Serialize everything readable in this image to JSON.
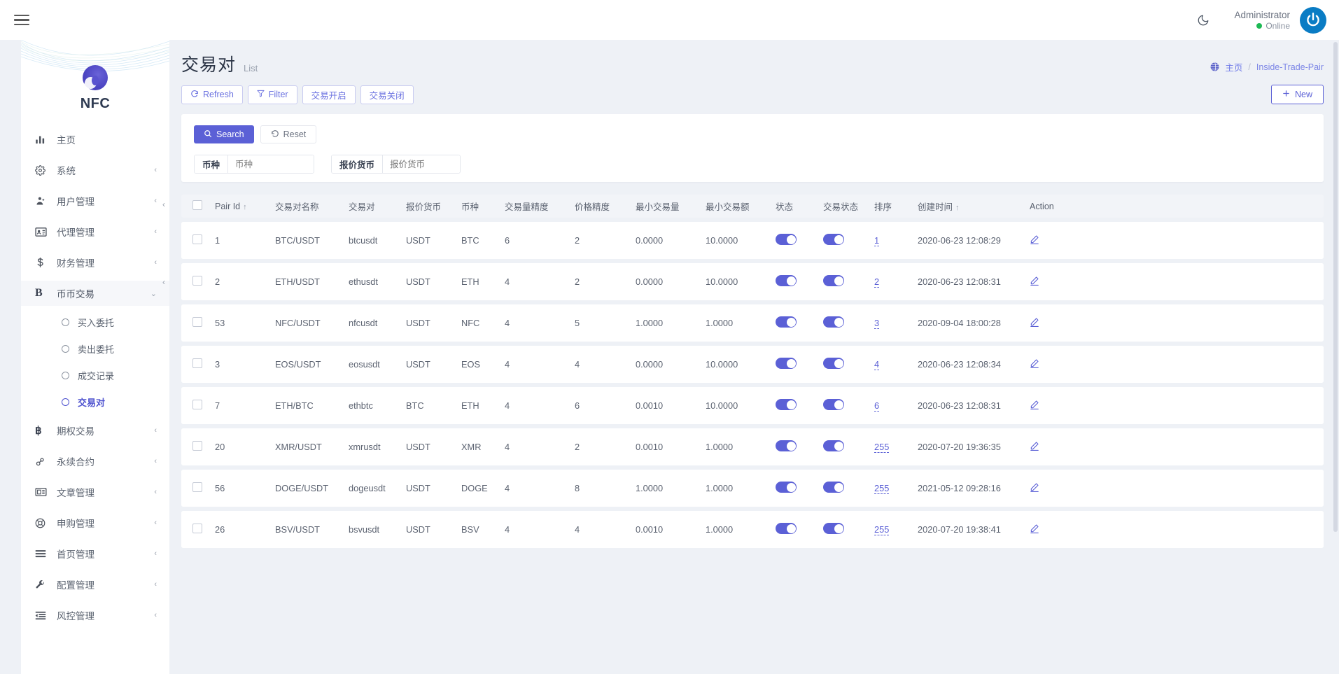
{
  "topbar": {
    "menu_icon": "hamburger-icon",
    "theme_icon": "moon-icon",
    "user_name": "Administrator",
    "user_status": "Online",
    "avatar_icon": "power-avatar-icon"
  },
  "sidebar": {
    "brand": "NFC",
    "items": [
      {
        "label": "主页",
        "icon": "chart-bar-icon",
        "arrow": "",
        "active": false
      },
      {
        "label": "系统",
        "icon": "gear-icon",
        "arrow": "‹",
        "active": false
      },
      {
        "label": "用户管理",
        "icon": "user-group-icon",
        "arrow": "‹",
        "active": false
      },
      {
        "label": "代理管理",
        "icon": "id-card-icon",
        "arrow": "‹",
        "active": false
      },
      {
        "label": "财务管理",
        "icon": "dollar-icon",
        "arrow": "‹",
        "active": false
      },
      {
        "label": "币币交易",
        "icon": "letter-b-icon",
        "arrow": "⌄",
        "active": true
      }
    ],
    "submenu": [
      {
        "label": "买入委托",
        "selected": false
      },
      {
        "label": "卖出委托",
        "selected": false
      },
      {
        "label": "成交记录",
        "selected": false
      },
      {
        "label": "交易对",
        "selected": true
      }
    ],
    "items_after": [
      {
        "label": "期权交易",
        "icon": "bitcoin-icon",
        "arrow": "‹"
      },
      {
        "label": "永续合约",
        "icon": "link-icon",
        "arrow": "‹"
      },
      {
        "label": "文章管理",
        "icon": "news-icon",
        "arrow": "‹"
      },
      {
        "label": "申购管理",
        "icon": "lifebuoy-icon",
        "arrow": "‹"
      },
      {
        "label": "首页管理",
        "icon": "list-icon",
        "arrow": "‹"
      },
      {
        "label": "配置管理",
        "icon": "wrench-icon",
        "arrow": "‹"
      },
      {
        "label": "风控管理",
        "icon": "indent-icon",
        "arrow": "‹"
      }
    ]
  },
  "page": {
    "title": "交易对",
    "subtitle": "List",
    "breadcrumb_home": "主页",
    "breadcrumb_sep": "/",
    "breadcrumb_current": "Inside-Trade-Pair"
  },
  "toolbar": {
    "refresh": "Refresh",
    "filter": "Filter",
    "trade_open": "交易开启",
    "trade_close": "交易关闭",
    "new": "New",
    "new_icon": "plus-icon",
    "refresh_icon": "refresh-icon",
    "filter_icon": "funnel-icon"
  },
  "search": {
    "search_label": "Search",
    "search_icon": "search-icon",
    "reset_label": "Reset",
    "reset_icon": "undo-icon",
    "fields": [
      {
        "label": "币种",
        "placeholder": "币种",
        "value": ""
      },
      {
        "label": "报价货币",
        "placeholder": "报价货币",
        "value": ""
      }
    ]
  },
  "table": {
    "columns": [
      "",
      "Pair Id",
      "交易对名称",
      "交易对",
      "报价货币",
      "币种",
      "交易量精度",
      "价格精度",
      "最小交易量",
      "最小交易额",
      "状态",
      "交易状态",
      "排序",
      "创建时间",
      "Action"
    ],
    "sorted_columns": {
      "pair_id": "↑",
      "created": "↑"
    },
    "rows": [
      {
        "pair_id": "1",
        "name": "BTC/USDT",
        "symbol": "btcusdt",
        "quote": "USDT",
        "coin": "BTC",
        "vol_prec": "6",
        "price_prec": "2",
        "min_vol": "0.0000",
        "min_amt": "10.0000",
        "status": true,
        "trade_status": true,
        "order": "1",
        "created": "2020-06-23 12:08:29",
        "action_icon": "pencil-icon"
      },
      {
        "pair_id": "2",
        "name": "ETH/USDT",
        "symbol": "ethusdt",
        "quote": "USDT",
        "coin": "ETH",
        "vol_prec": "4",
        "price_prec": "2",
        "min_vol": "0.0000",
        "min_amt": "10.0000",
        "status": true,
        "trade_status": true,
        "order": "2",
        "created": "2020-06-23 12:08:31",
        "action_icon": "pencil-icon"
      },
      {
        "pair_id": "53",
        "name": "NFC/USDT",
        "symbol": "nfcusdt",
        "quote": "USDT",
        "coin": "NFC",
        "vol_prec": "4",
        "price_prec": "5",
        "min_vol": "1.0000",
        "min_amt": "1.0000",
        "status": true,
        "trade_status": true,
        "order": "3",
        "created": "2020-09-04 18:00:28",
        "action_icon": "pencil-icon"
      },
      {
        "pair_id": "3",
        "name": "EOS/USDT",
        "symbol": "eosusdt",
        "quote": "USDT",
        "coin": "EOS",
        "vol_prec": "4",
        "price_prec": "4",
        "min_vol": "0.0000",
        "min_amt": "10.0000",
        "status": true,
        "trade_status": true,
        "order": "4",
        "created": "2020-06-23 12:08:34",
        "action_icon": "pencil-icon"
      },
      {
        "pair_id": "7",
        "name": "ETH/BTC",
        "symbol": "ethbtc",
        "quote": "BTC",
        "coin": "ETH",
        "vol_prec": "4",
        "price_prec": "6",
        "min_vol": "0.0010",
        "min_amt": "10.0000",
        "status": true,
        "trade_status": true,
        "order": "6",
        "created": "2020-06-23 12:08:31",
        "action_icon": "pencil-icon"
      },
      {
        "pair_id": "20",
        "name": "XMR/USDT",
        "symbol": "xmrusdt",
        "quote": "USDT",
        "coin": "XMR",
        "vol_prec": "4",
        "price_prec": "2",
        "min_vol": "0.0010",
        "min_amt": "1.0000",
        "status": true,
        "trade_status": true,
        "order": "255",
        "created": "2020-07-20 19:36:35",
        "action_icon": "pencil-icon"
      },
      {
        "pair_id": "56",
        "name": "DOGE/USDT",
        "symbol": "dogeusdt",
        "quote": "USDT",
        "coin": "DOGE",
        "vol_prec": "4",
        "price_prec": "8",
        "min_vol": "1.0000",
        "min_amt": "1.0000",
        "status": true,
        "trade_status": true,
        "order": "255",
        "created": "2021-05-12 09:28:16",
        "action_icon": "pencil-icon"
      },
      {
        "pair_id": "26",
        "name": "BSV/USDT",
        "symbol": "bsvusdt",
        "quote": "USDT",
        "coin": "BSV",
        "vol_prec": "4",
        "price_prec": "4",
        "min_vol": "0.0010",
        "min_amt": "1.0000",
        "status": true,
        "trade_status": true,
        "order": "255",
        "created": "2020-07-20 19:38:41",
        "action_icon": "pencil-icon"
      }
    ]
  },
  "colors": {
    "accent": "#5b60d6",
    "page_bg": "#eef1f6",
    "header_bg": "#f2f4f8",
    "online": "#1db954",
    "avatar": "#0a7cc4"
  }
}
